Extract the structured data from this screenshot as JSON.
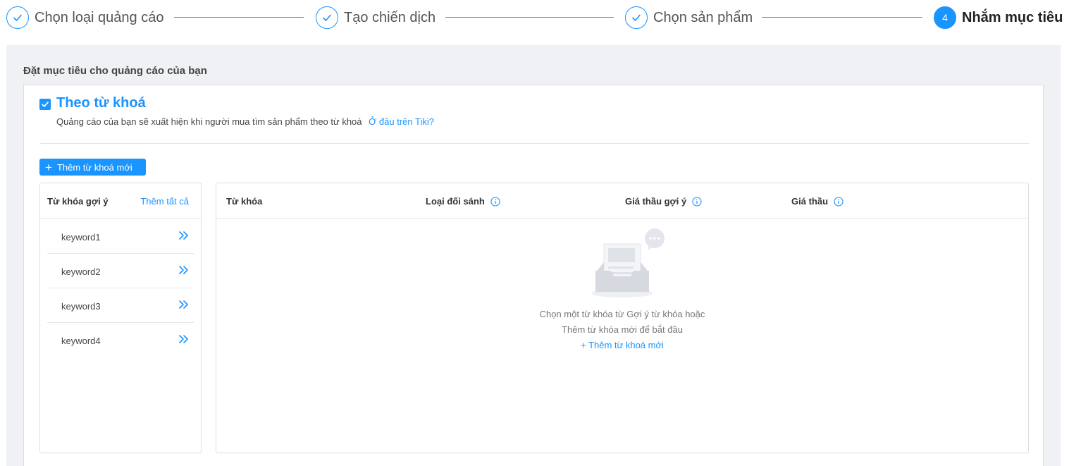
{
  "steps": [
    {
      "label": "Chọn loại quảng cáo",
      "state": "done"
    },
    {
      "label": "Tạo chiến dịch",
      "state": "done"
    },
    {
      "label": "Chọn sản phẩm",
      "state": "done"
    },
    {
      "label": "Nhắm mục tiêu",
      "number": "4",
      "state": "active"
    }
  ],
  "panel": {
    "title": "Đặt mục tiêu cho quảng cáo của bạn"
  },
  "keyword_section": {
    "checked": true,
    "title": "Theo từ khoá",
    "description": "Quảng cáo của bạn sẽ xuất hiện khi người mua tìm sản phẩm theo từ khoá",
    "help_link": "Ở đâu trên Tiki?",
    "add_button": "Thêm từ khoá mới"
  },
  "suggestions": {
    "header": "Từ khóa gợi ý",
    "add_all": "Thêm tất cả",
    "items": [
      {
        "label": "keyword1"
      },
      {
        "label": "keyword2"
      },
      {
        "label": "keyword3"
      },
      {
        "label": "keyword4"
      }
    ]
  },
  "table": {
    "columns": [
      "Từ khóa",
      "Loại đối sánh",
      "Giá thầu gợi ý",
      "Giá thầu"
    ],
    "empty_line1": "Chọn một từ khóa từ Gợi ý từ khóa hoặc",
    "empty_line2": "Thêm từ khóa mới để bắt đầu",
    "empty_link": "+ Thêm từ khoá mới"
  },
  "colors": {
    "accent": "#1a94ff",
    "panel_bg": "#f0f1f5",
    "border": "#dcdde2"
  }
}
